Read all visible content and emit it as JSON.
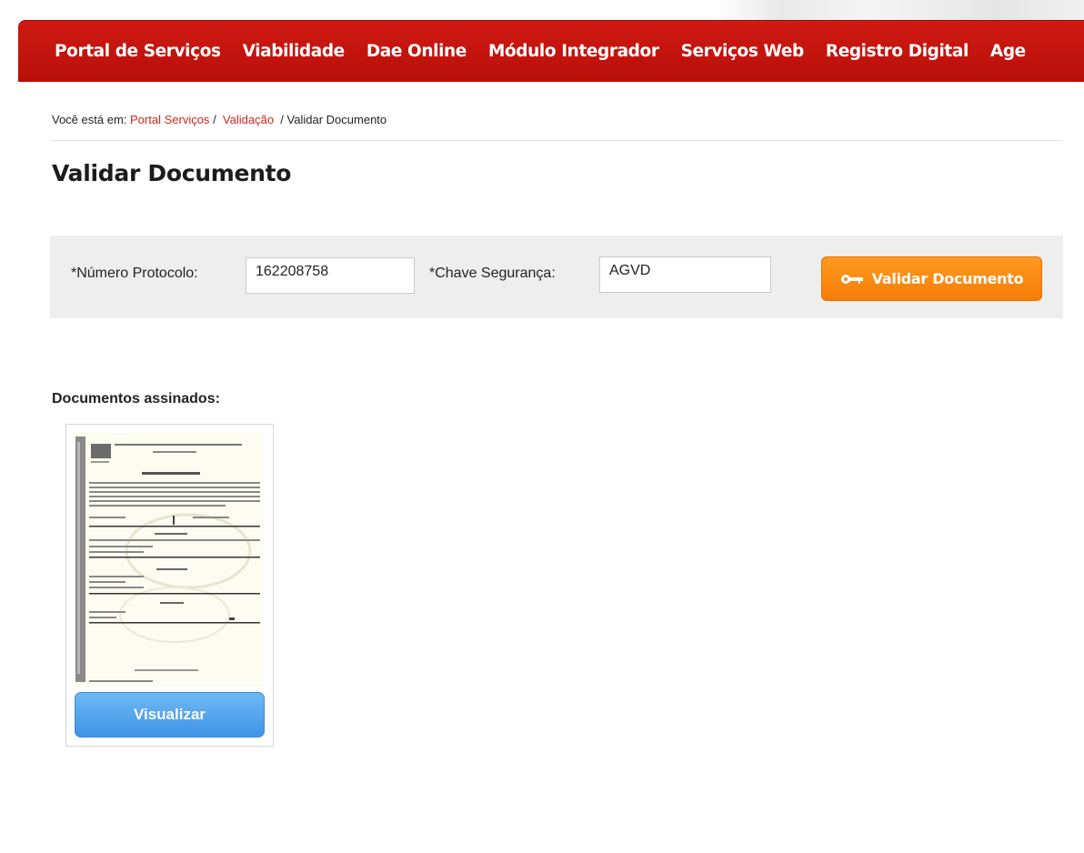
{
  "nav": {
    "items": [
      "Portal de Serviços",
      "Viabilidade",
      "Dae Online",
      "Módulo Integrador",
      "Serviços Web",
      "Registro Digital",
      "Age"
    ]
  },
  "breadcrumb": {
    "prefix": "Você está em:",
    "link1": "Portal Serviços",
    "sep1": "/",
    "link2": "Validação",
    "sep2": "/",
    "current": "Validar Documento"
  },
  "page": {
    "title": "Validar Documento"
  },
  "form": {
    "protocolo_label": "*Número Protocolo:",
    "protocolo_value": "162208758",
    "chave_label": "*Chave Segurança:",
    "chave_value": "AGVD",
    "submit_label": "Validar Documento"
  },
  "documents": {
    "title": "Documentos assinados:",
    "view_label": "Visualizar"
  },
  "colors": {
    "nav_red": "#c4140e",
    "link_red": "#d0251f",
    "button_orange": "#f98a10",
    "button_blue": "#4d9fe8"
  }
}
